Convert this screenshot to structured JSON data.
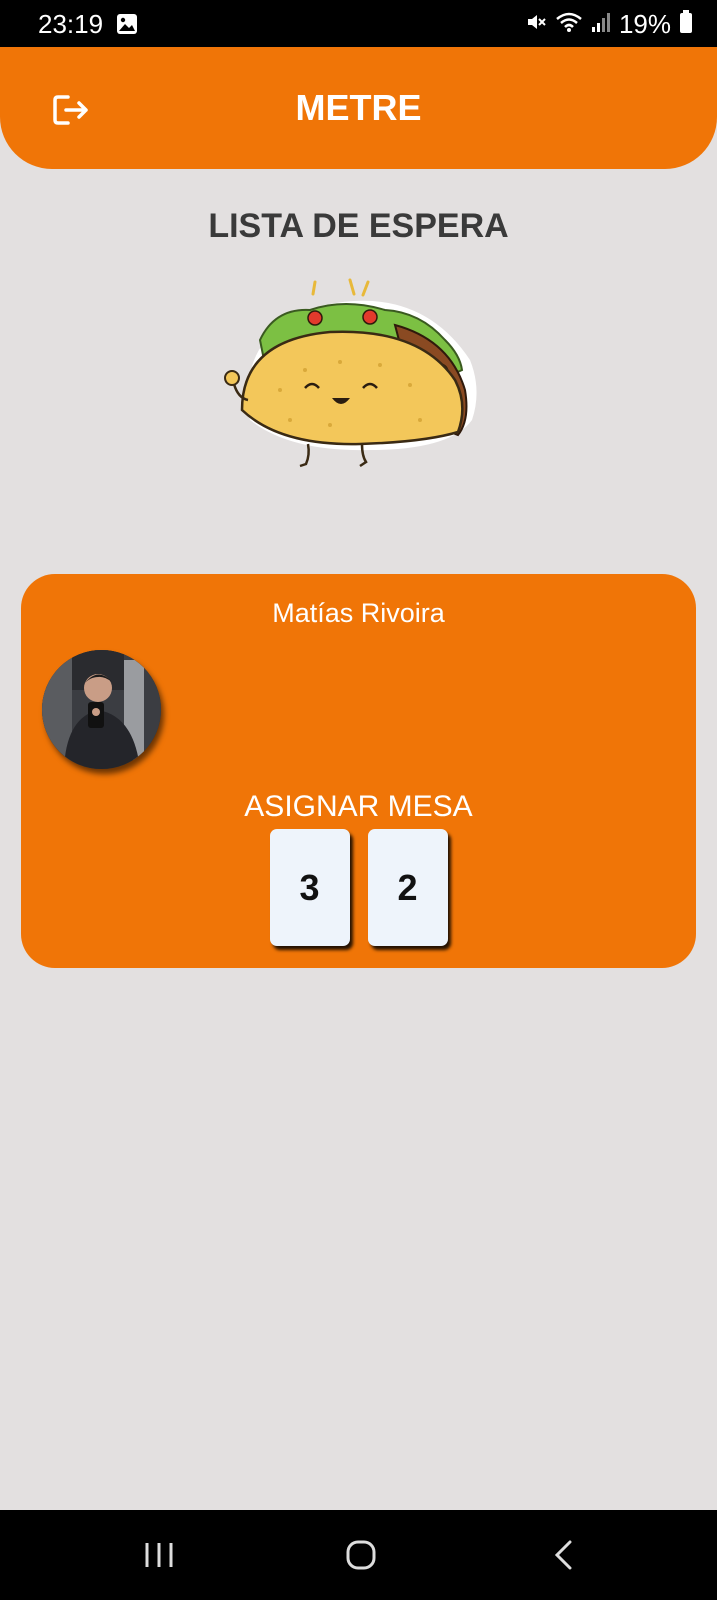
{
  "status_bar": {
    "time": "23:19",
    "battery": "19%",
    "icons": [
      "gallery-icon",
      "mute-icon",
      "wifi-icon",
      "signal-icon",
      "battery-icon"
    ]
  },
  "header": {
    "title": "METRE",
    "logout_icon": "logout-icon",
    "color": "#f07507"
  },
  "page": {
    "title": "LISTA DE ESPERA",
    "illustration": "taco-mascot"
  },
  "waiting_list": [
    {
      "name": "Matías Rivoira",
      "assign_label": "ASIGNAR MESA",
      "tables": [
        "3",
        "2"
      ]
    }
  ],
  "nav_bar": {
    "icons": [
      "recents-icon",
      "home-icon",
      "back-icon"
    ]
  },
  "colors": {
    "accent": "#f07507",
    "background": "#e3e0e0",
    "title_text": "#3a3a3a",
    "table_button": "#eef4fb"
  }
}
